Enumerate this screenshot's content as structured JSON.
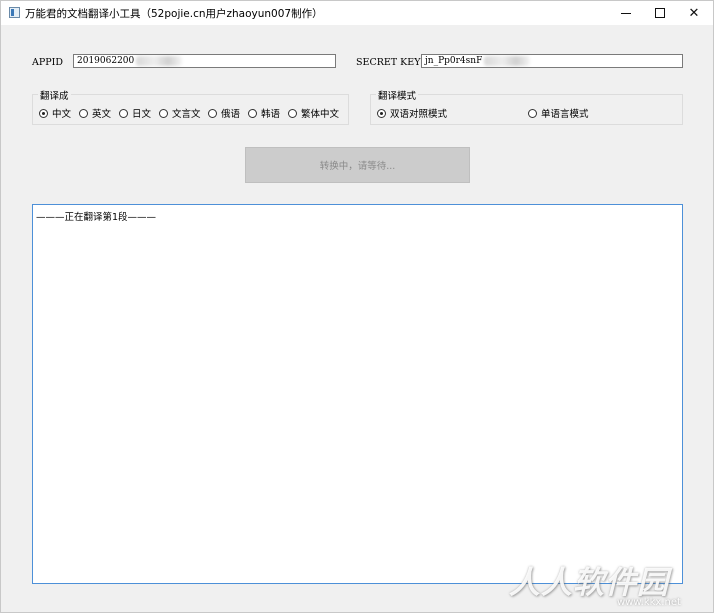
{
  "window": {
    "title": "万能君的文档翻译小工具（52pojie.cn用户zhaoyun007制作）"
  },
  "credentials": {
    "appid_label": "APPID",
    "appid_value": "2019062200",
    "secret_label": "SECRET KEY",
    "secret_value": "jn_Pp0r4snF"
  },
  "target_language": {
    "legend": "翻译成",
    "options": [
      {
        "label": "中文",
        "checked": true
      },
      {
        "label": "英文",
        "checked": false
      },
      {
        "label": "日文",
        "checked": false
      },
      {
        "label": "文言文",
        "checked": false
      },
      {
        "label": "俄语",
        "checked": false
      },
      {
        "label": "韩语",
        "checked": false
      },
      {
        "label": "繁体中文",
        "checked": false
      }
    ]
  },
  "mode": {
    "legend": "翻译模式",
    "options": [
      {
        "label": "双语对照模式",
        "checked": true
      },
      {
        "label": "单语言模式",
        "checked": false
      }
    ]
  },
  "action": {
    "label": "转换中，请等待..."
  },
  "output": {
    "text": "———正在翻译第1段———"
  },
  "watermark": {
    "main": "人人软件园",
    "url": "www.kkx.net"
  }
}
